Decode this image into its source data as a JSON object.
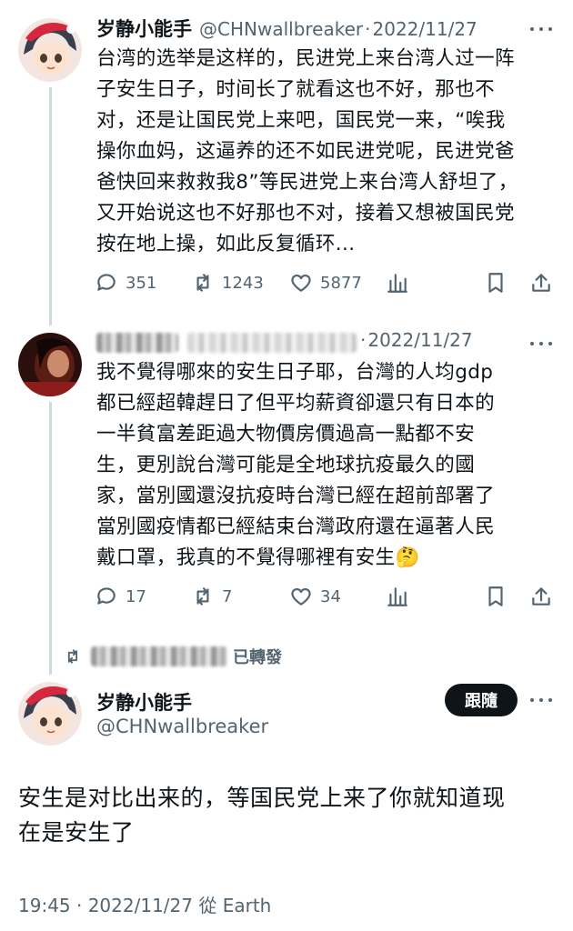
{
  "tweet1": {
    "display_name": "岁静小能手",
    "handle": "@CHNwallbreaker",
    "separator": "·",
    "date": "2022/11/27",
    "text_lines": [
      "台湾的选举是这样的，民进党上来台湾人过一阵",
      "子安生日子，时间长了就看这也不好，那也不",
      "对，还是让国民党上来吧，国民党一来，“唉我",
      "操你血妈，这逼养的还不如民进党呢，民进党爸",
      "爸快回来救救我8”等民进党上来台湾人舒坦了，",
      "又开始说这也不好那也不对，接着又想被国民党",
      "按在地上操，如此反复循环..."
    ],
    "replies": "351",
    "retweets": "1243",
    "likes": "5877"
  },
  "tweet2": {
    "separator": "·",
    "date": "2022/11/27",
    "text_lines": [
      "我不覺得哪來的安生日子耶，台灣的人均gdp",
      "都已經超韓趕日了但平均薪資卻還只有日本的",
      "一半貧富差距過大物價房價過高一點都不安",
      "生，更別說台灣可能是全地球抗疫最久的國",
      "家，當別國還沒抗疫時台灣已經在超前部署了",
      "當別國疫情都已經結束台灣政府還在逼著人民",
      "戴口罩，我真的不覺得哪裡有安生"
    ],
    "emoji": "🤔",
    "replies": "17",
    "retweets": "7",
    "likes": "34"
  },
  "retweet_label": "已轉發",
  "main_tweet": {
    "display_name": "岁静小能手",
    "handle": "@CHNwallbreaker",
    "follow_label": "跟隨",
    "text_lines": [
      "安生是对比出来的，等国民党上来了你就知道现",
      "在是安生了"
    ],
    "timestamp": "19:45 · 2022/11/27 從 Earth"
  },
  "icons": [
    "more-icon",
    "reply-icon",
    "retweet-icon",
    "like-icon",
    "views-icon",
    "bookmark-icon",
    "share-icon"
  ],
  "colors": {
    "text": "#0f1419",
    "secondary": "#536471",
    "follow_bg": "#0f1419",
    "thread_line": "#cfd9de"
  }
}
